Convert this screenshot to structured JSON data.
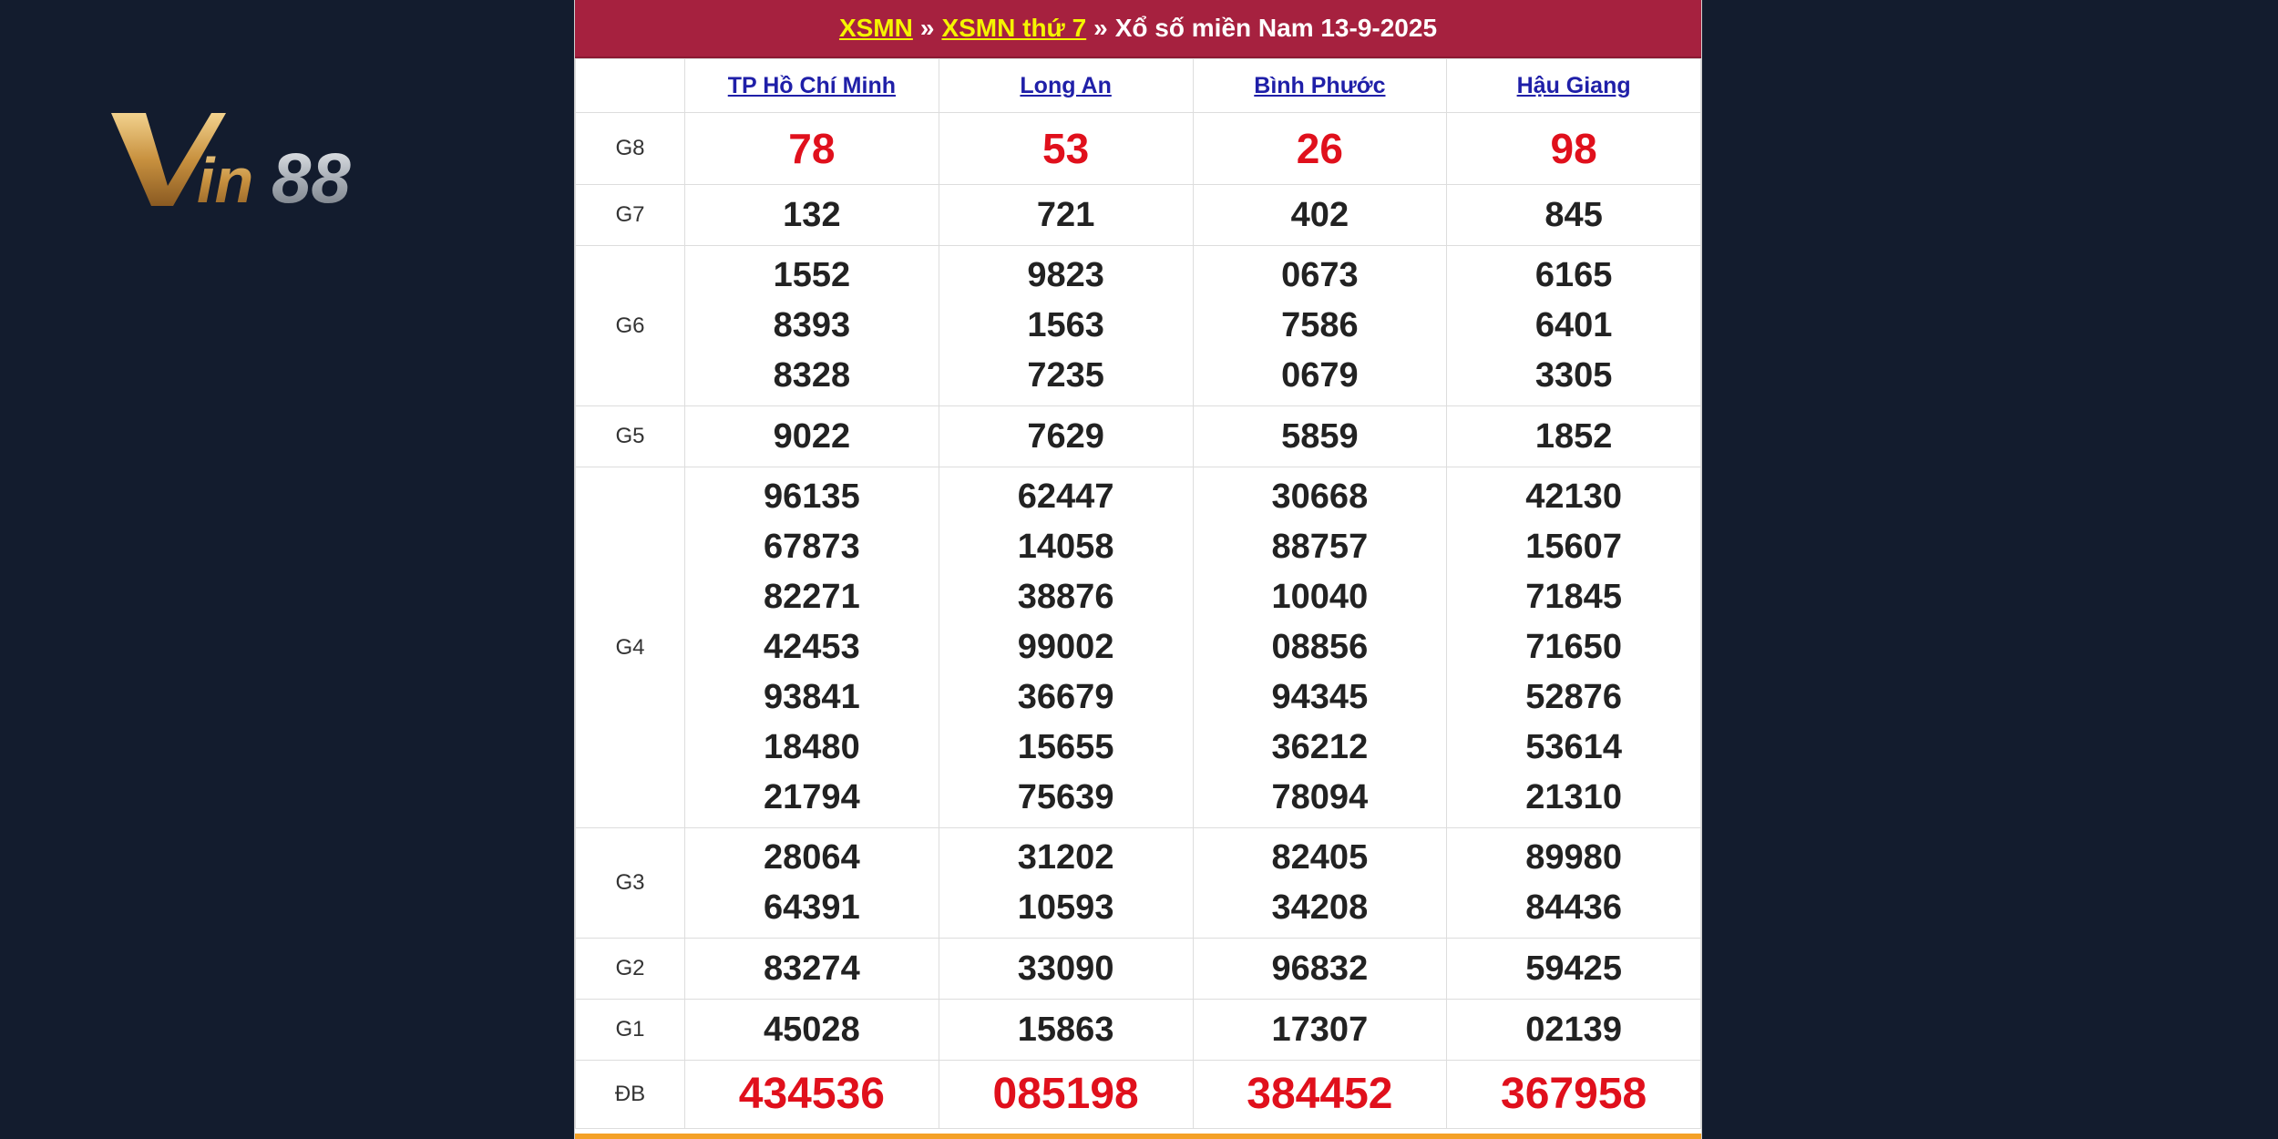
{
  "logo": {
    "text": "Vin88",
    "colors": {
      "gold": "#d8a756",
      "silver": "#c8ccd2"
    }
  },
  "header": {
    "crumb1": "XSMN",
    "sep1": "»",
    "crumb2": "XSMN thứ 7",
    "sep2": "»",
    "title": "Xổ số miền Nam 13-9-2025"
  },
  "provinces": [
    "TP Hồ Chí Minh",
    "Long An",
    "Bình Phước",
    "Hậu Giang"
  ],
  "rows": [
    {
      "label": "G8",
      "cls": "g8",
      "values": [
        [
          "78"
        ],
        [
          "53"
        ],
        [
          "26"
        ],
        [
          "98"
        ]
      ]
    },
    {
      "label": "G7",
      "cls": "g7",
      "values": [
        [
          "132"
        ],
        [
          "721"
        ],
        [
          "402"
        ],
        [
          "845"
        ]
      ]
    },
    {
      "label": "G6",
      "cls": "g6",
      "values": [
        [
          "1552",
          "8393",
          "8328"
        ],
        [
          "9823",
          "1563",
          "7235"
        ],
        [
          "0673",
          "7586",
          "0679"
        ],
        [
          "6165",
          "6401",
          "3305"
        ]
      ]
    },
    {
      "label": "G5",
      "cls": "g5",
      "values": [
        [
          "9022"
        ],
        [
          "7629"
        ],
        [
          "5859"
        ],
        [
          "1852"
        ]
      ]
    },
    {
      "label": "G4",
      "cls": "g4",
      "values": [
        [
          "96135",
          "67873",
          "82271",
          "42453",
          "93841",
          "18480",
          "21794"
        ],
        [
          "62447",
          "14058",
          "38876",
          "99002",
          "36679",
          "15655",
          "75639"
        ],
        [
          "30668",
          "88757",
          "10040",
          "08856",
          "94345",
          "36212",
          "78094"
        ],
        [
          "42130",
          "15607",
          "71845",
          "71650",
          "52876",
          "53614",
          "21310"
        ]
      ]
    },
    {
      "label": "G3",
      "cls": "g3",
      "values": [
        [
          "28064",
          "64391"
        ],
        [
          "31202",
          "10593"
        ],
        [
          "82405",
          "34208"
        ],
        [
          "89980",
          "84436"
        ]
      ]
    },
    {
      "label": "G2",
      "cls": "g2",
      "values": [
        [
          "83274"
        ],
        [
          "33090"
        ],
        [
          "96832"
        ],
        [
          "59425"
        ]
      ]
    },
    {
      "label": "G1",
      "cls": "g1",
      "values": [
        [
          "45028"
        ],
        [
          "15863"
        ],
        [
          "17307"
        ],
        [
          "02139"
        ]
      ]
    },
    {
      "label": "ĐB",
      "cls": "gdb",
      "values": [
        [
          "434536"
        ],
        [
          "085198"
        ],
        [
          "384452"
        ],
        [
          "367958"
        ]
      ]
    }
  ],
  "colors": {
    "header_bg": "#a6213f",
    "link_yellow": "#f5f500",
    "province_link": "#1f1fa8",
    "red_number": "#e0101c",
    "page_bg": "#131c2e"
  }
}
